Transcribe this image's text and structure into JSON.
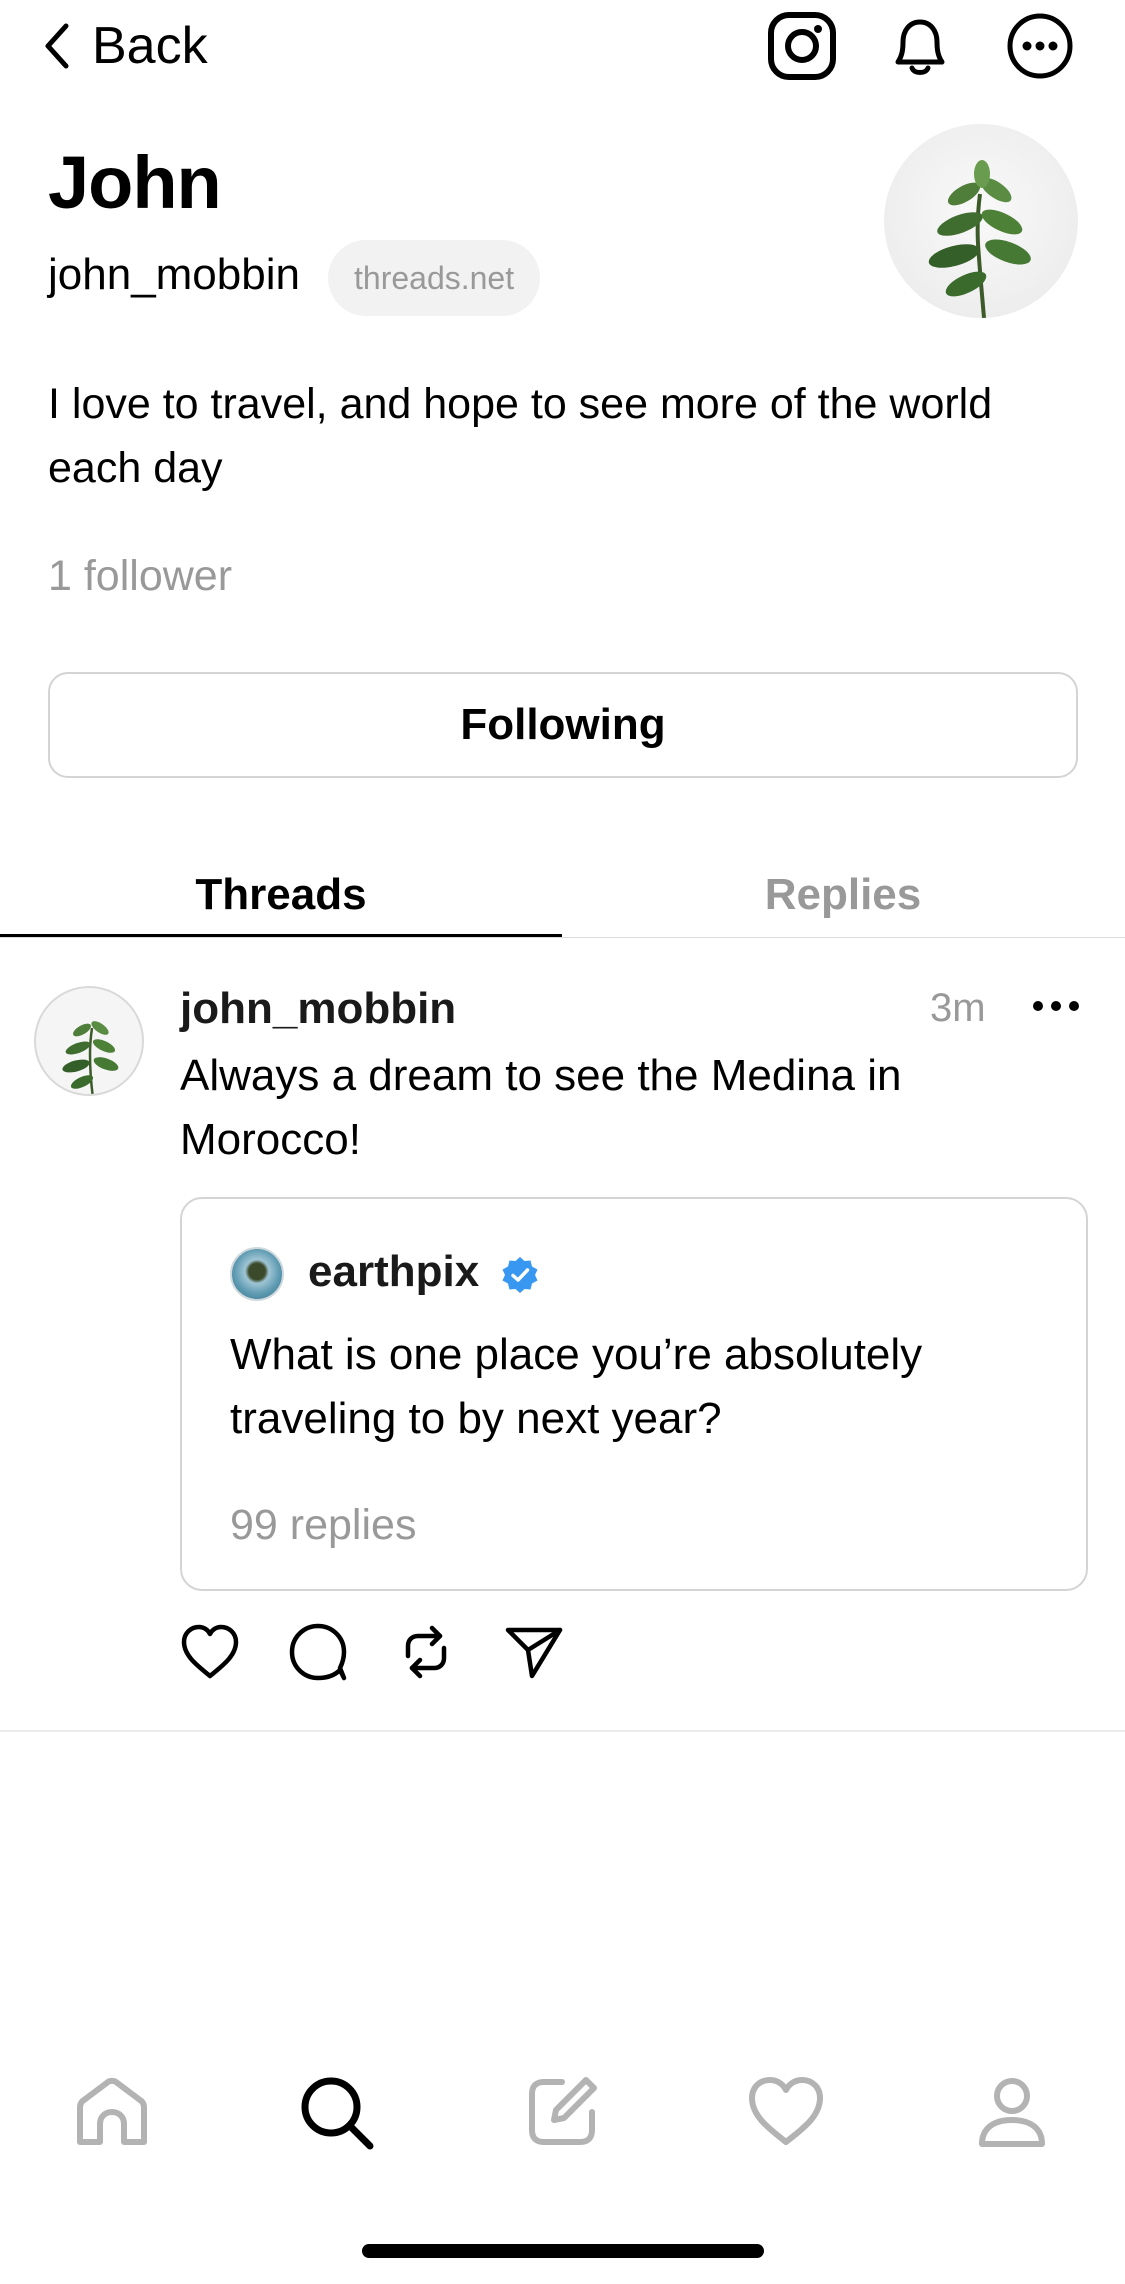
{
  "header": {
    "back_label": "Back"
  },
  "profile": {
    "name": "John",
    "username": "john_mobbin",
    "domain": "threads.net",
    "bio": "I love to travel, and hope to see more of the world each day",
    "followers": "1 follower",
    "follow_button_label": "Following"
  },
  "tabs": [
    {
      "label": "Threads",
      "active": true
    },
    {
      "label": "Replies",
      "active": false
    }
  ],
  "post": {
    "author": "john_mobbin",
    "time": "3m",
    "text": "Always a dream to see the Medina in Morocco!",
    "quote": {
      "author": "earthpix",
      "verified": true,
      "text": "What is one place you’re absolutely traveling to by next year?",
      "replies": "99 replies"
    },
    "actions": [
      "heart-icon",
      "comment-icon",
      "repost-icon",
      "share-icon"
    ]
  },
  "bottom_nav": {
    "items": [
      "home-icon",
      "search-icon",
      "compose-icon",
      "activity-heart-icon",
      "profile-icon"
    ],
    "active": "search-icon"
  },
  "colors": {
    "text": "#000000",
    "muted": "#999999",
    "border": "#d4d4d4",
    "verified": "#3897f0",
    "inactive_nav": "#b3b3b3"
  }
}
